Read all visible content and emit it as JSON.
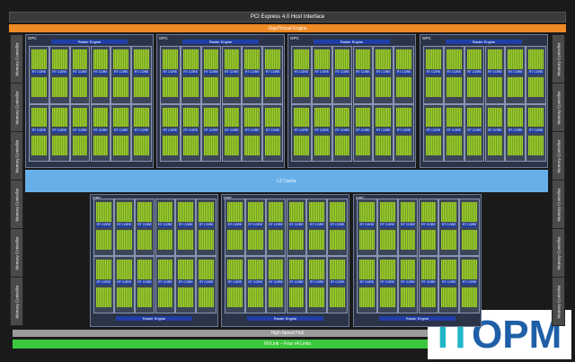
{
  "header": {
    "pcie_label": "PCI Express 4.0 Host Interface",
    "gigathread_label": "GigaThread Engine"
  },
  "memory_controller_label": "Memory Controller",
  "gpc_label": "GPC",
  "raster_label": "Raster Engine",
  "rt_core_label": "RT CORE",
  "l2_label": "L2 Cache",
  "hub_label": "High-Speed Hub",
  "nvlink_label": "NVLink – Four x4 Links",
  "watermark": {
    "text_it": "IT",
    "text_opm": "OPM"
  },
  "colors": {
    "pcie": "#3a3a3a",
    "gigathread": "#f08a24",
    "l2": "#67afe8",
    "nvlink": "#3cc83c",
    "sm_green": "#9ed12e",
    "raster": "#1f3ea8",
    "watermark_it": "#20b8c8",
    "watermark_opm": "#1f5fa8"
  }
}
